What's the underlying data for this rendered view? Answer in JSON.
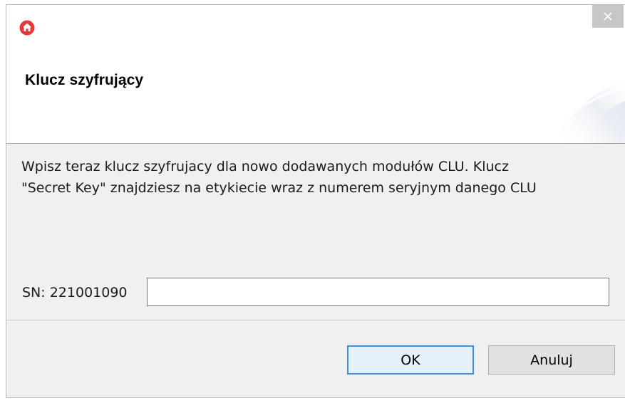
{
  "window": {
    "app_icon": "home-icon",
    "close_icon": "close-icon"
  },
  "header": {
    "title": "Klucz szyfrujący"
  },
  "message": {
    "line1": "Wpisz teraz klucz szyfrujacy dla nowo dodawanych modułów CLU. Klucz",
    "line2": "\"Secret Key\" znajdziesz na etykiecie wraz z numerem seryjnym danego CLU"
  },
  "form": {
    "sn_label": "SN: 221001090",
    "key_value": ""
  },
  "buttons": {
    "ok_label": "OK",
    "cancel_label": "Anuluj"
  },
  "colors": {
    "app_icon": "#e03c3c",
    "ok_border": "#3c8fd9",
    "close_bg": "#c7c7c7"
  }
}
